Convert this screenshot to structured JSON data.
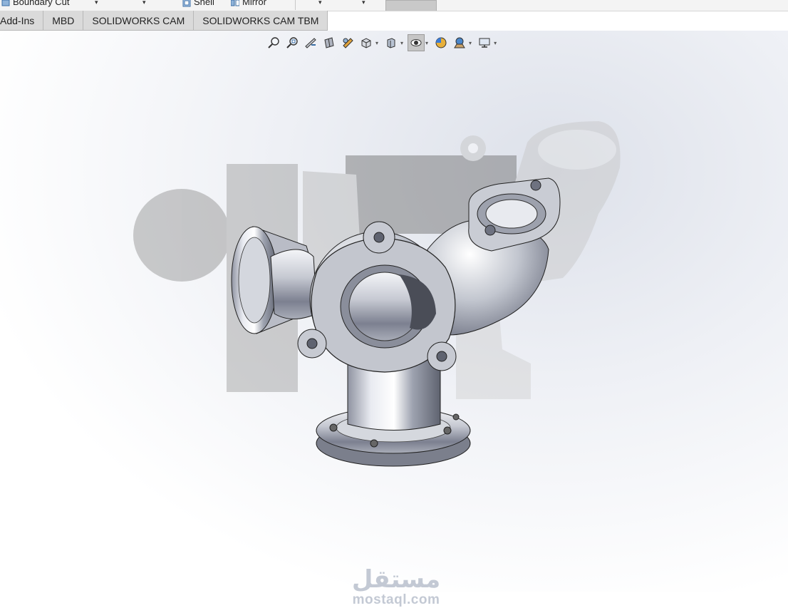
{
  "ribbon": {
    "boundary_cut_label": "Boundary Cut",
    "shell_label": "Shell",
    "mirror_label": "Mirror"
  },
  "tabs": [
    {
      "label": "Add-Ins"
    },
    {
      "label": "MBD"
    },
    {
      "label": "SOLIDWORKS CAM"
    },
    {
      "label": "SOLIDWORKS CAM TBM"
    }
  ],
  "heads_up_toolbar": [
    "zoom-to-fit-icon",
    "zoom-to-area-icon",
    "previous-view-icon",
    "section-view-icon",
    "dynamic-annotation-icon",
    "view-orientation-icon",
    "display-style-icon",
    "hide-show-items-icon",
    "edit-appearance-icon",
    "apply-scene-icon",
    "view-settings-icon"
  ],
  "watermark": {
    "arabic": "مستقل",
    "latin": "mostaql.com"
  }
}
